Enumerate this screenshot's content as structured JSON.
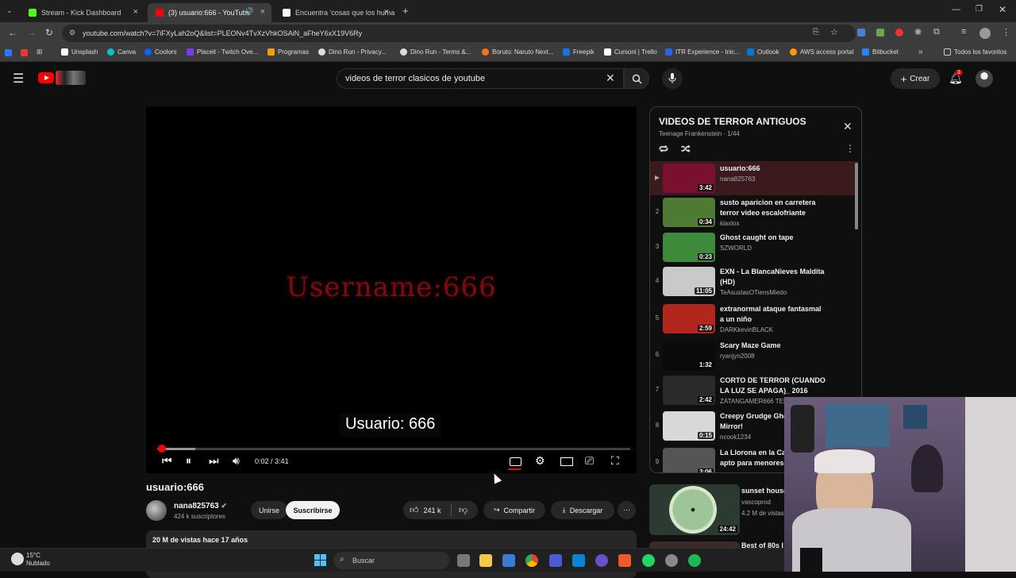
{
  "browser": {
    "tabs": [
      {
        "title": "Stream - Kick Dashboard",
        "favicon_color": "#53fc18"
      },
      {
        "title": "(3) usuario:666 - YouTube",
        "favicon_color": "#ff0000"
      },
      {
        "title": "Encuentra 'cosas que los huma",
        "favicon_color": "#ffffff"
      }
    ],
    "url": "youtube.com/watch?v=7iFXyLah2oQ&list=PLEONv4TvXzVhkOSAiN_aFheY6xX19V6Ry",
    "bookmarks": [
      {
        "label": "Unsplash",
        "color": "#ffffff"
      },
      {
        "label": "Canva",
        "color": "#00c4cc"
      },
      {
        "label": "Coolors",
        "color": "#0066ff"
      },
      {
        "label": "Placeit - Twitch Ove...",
        "color": "#7c3aed"
      },
      {
        "label": "Programas",
        "color": "#f59e0b"
      },
      {
        "label": "Dino Run - Privacy...",
        "color": "#dddddd"
      },
      {
        "label": "Dino Run - Terms &...",
        "color": "#dddddd"
      },
      {
        "label": "Boruto: Naruto Next...",
        "color": "#f97316"
      },
      {
        "label": "Freepik",
        "color": "#1273eb"
      },
      {
        "label": "Cursoni | Trello",
        "color": "#ffffff"
      },
      {
        "label": "ITR Experience - Inic...",
        "color": "#2563eb"
      },
      {
        "label": "Outlook",
        "color": "#0078d4"
      },
      {
        "label": "AWS access portal",
        "color": "#ff9900"
      },
      {
        "label": "Bitbucket",
        "color": "#2684ff"
      }
    ],
    "all_favorites_label": "Todos los favoritos"
  },
  "header": {
    "search_query": "videos de terror clasicos de youtube",
    "create_label": "Crear",
    "notification_count": "3"
  },
  "player": {
    "video_text": "Username:666",
    "caption": "Usuario: 666",
    "time_current": "0:02",
    "time_total": "3:41",
    "progress": 0.01,
    "buffered": 0.08
  },
  "video": {
    "title": "usuario:666",
    "channel": "nana825763",
    "subscribers": "424 k suscriptores",
    "join_label": "Unirse",
    "subscribe_label": "Suscribirse",
    "likes": "241 k",
    "share_label": "Compartir",
    "download_label": "Descargar",
    "views": "20 M de vistas",
    "published": "hace 17 años"
  },
  "playlist": {
    "title": "VIDEOS DE TERROR ANTIGUOS",
    "subtitle": "Teenage Frankenstein · 1/44",
    "items": [
      {
        "index": "▶",
        "title_line1": "usuario:666",
        "title_line2": "",
        "channel": "nana825763",
        "duration": "3:42",
        "thumb": "#7a1030"
      },
      {
        "index": "2",
        "title_line1": "susto aparicion en carretera",
        "title_line2": "terror video escalofriante",
        "channel": "klaxlox",
        "duration": "0:34",
        "thumb": "#4f7a33"
      },
      {
        "index": "3",
        "title_line1": "Ghost caught on tape",
        "title_line2": "",
        "channel": "SZWORLD",
        "duration": "0:23",
        "thumb": "#3c8a3a"
      },
      {
        "index": "4",
        "title_line1": "EXN - La BlancaNieves Maldita",
        "title_line2": "(HD)",
        "channel": "TeAsustasOTiensMiedo",
        "duration": "11:05",
        "thumb": "#c9c9c9"
      },
      {
        "index": "5",
        "title_line1": "extranormal ataque fantasmal",
        "title_line2": "a un niño",
        "channel": "DARKkevinBLACK",
        "duration": "2:59",
        "thumb": "#b3261e"
      },
      {
        "index": "6",
        "title_line1": "Scary Maze Game",
        "title_line2": "",
        "channel": "ryanjyn2008",
        "duration": "1:32",
        "thumb": "#0a0a0a"
      },
      {
        "index": "7",
        "title_line1": "CORTO DE TERROR (CUANDO",
        "title_line2": "LA LUZ SE APAGA)_ 2016",
        "channel": "ZATANGAMER666 TER...",
        "duration": "2:42",
        "thumb": "#2a2a2a"
      },
      {
        "index": "8",
        "title_line1": "Creepy Grudge Ghos",
        "title_line2": "Mirror!",
        "channel": "ncook1234",
        "duration": "0:15",
        "thumb": "#d8d8d8"
      },
      {
        "index": "9",
        "title_line1": "La Llorona en la Car",
        "title_line2": "apto para menores,",
        "channel": "",
        "duration": "3:06",
        "thumb": "#555555"
      }
    ]
  },
  "recommended": [
    {
      "title": "sunset house",
      "channel": "vascoprod",
      "views": "4.2 M de vistas",
      "duration": "24:42"
    },
    {
      "title": "Best of 80s I"
    }
  ],
  "taskbar": {
    "search_label": "Buscar",
    "temperature": "15°C",
    "weather": "Nublado"
  }
}
